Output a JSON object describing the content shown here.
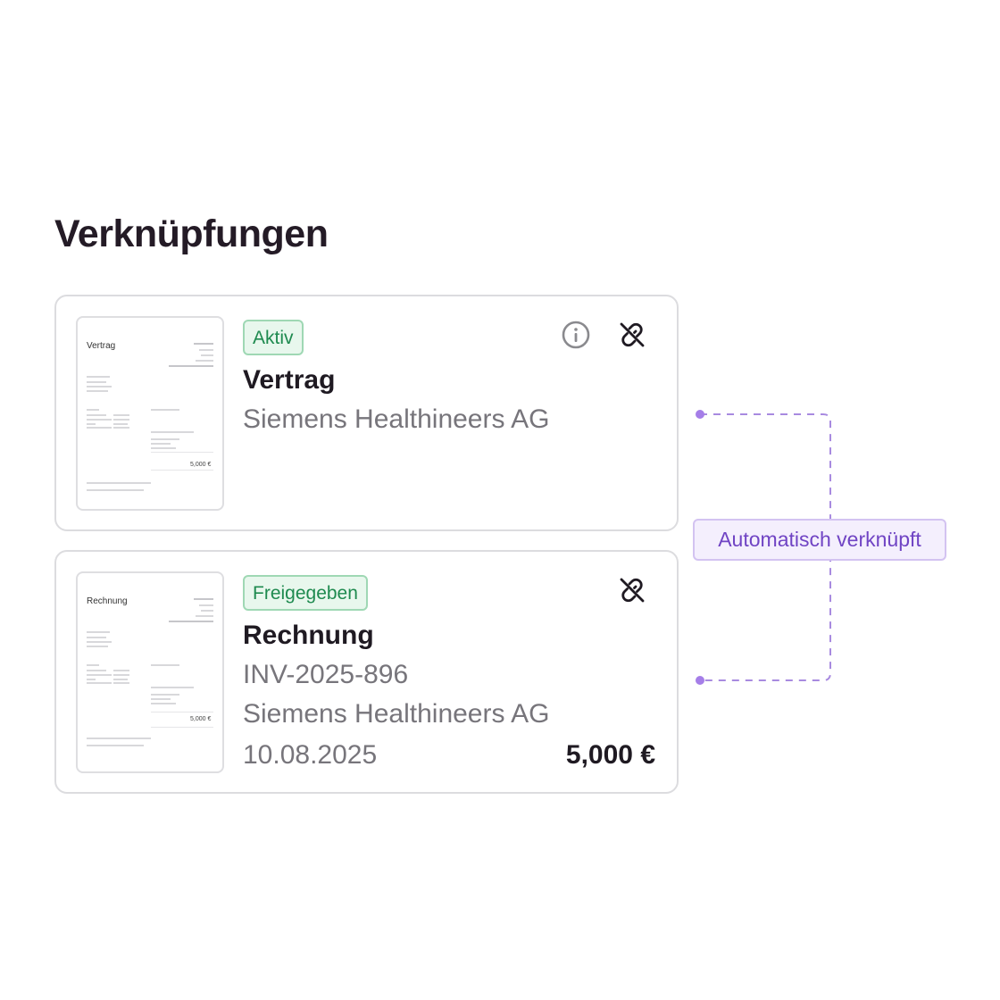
{
  "section": {
    "title": "Verknüpfungen"
  },
  "cards": [
    {
      "thumbnail": {
        "title": "Vertrag",
        "amount": "5,000 €"
      },
      "status": "Aktiv",
      "doc_type": "Vertrag",
      "company": "Siemens Healthineers AG"
    },
    {
      "thumbnail": {
        "title": "Rechnung",
        "amount": "5,000 €"
      },
      "status": "Freigegeben",
      "doc_type": "Rechnung",
      "invoice_number": "INV-2025-896",
      "company": "Siemens Healthineers AG",
      "date": "10.08.2025",
      "amount": "5,000 €"
    }
  ],
  "connector": {
    "label": "Automatisch verknüpft"
  },
  "icons": {
    "info": "info-icon",
    "unlink": "unlink-icon"
  },
  "colors": {
    "status_green": "#1e8a4f",
    "status_green_bg": "#e8f7ed",
    "accent_purple": "#7044c4",
    "accent_purple_bg": "#f4effd"
  }
}
